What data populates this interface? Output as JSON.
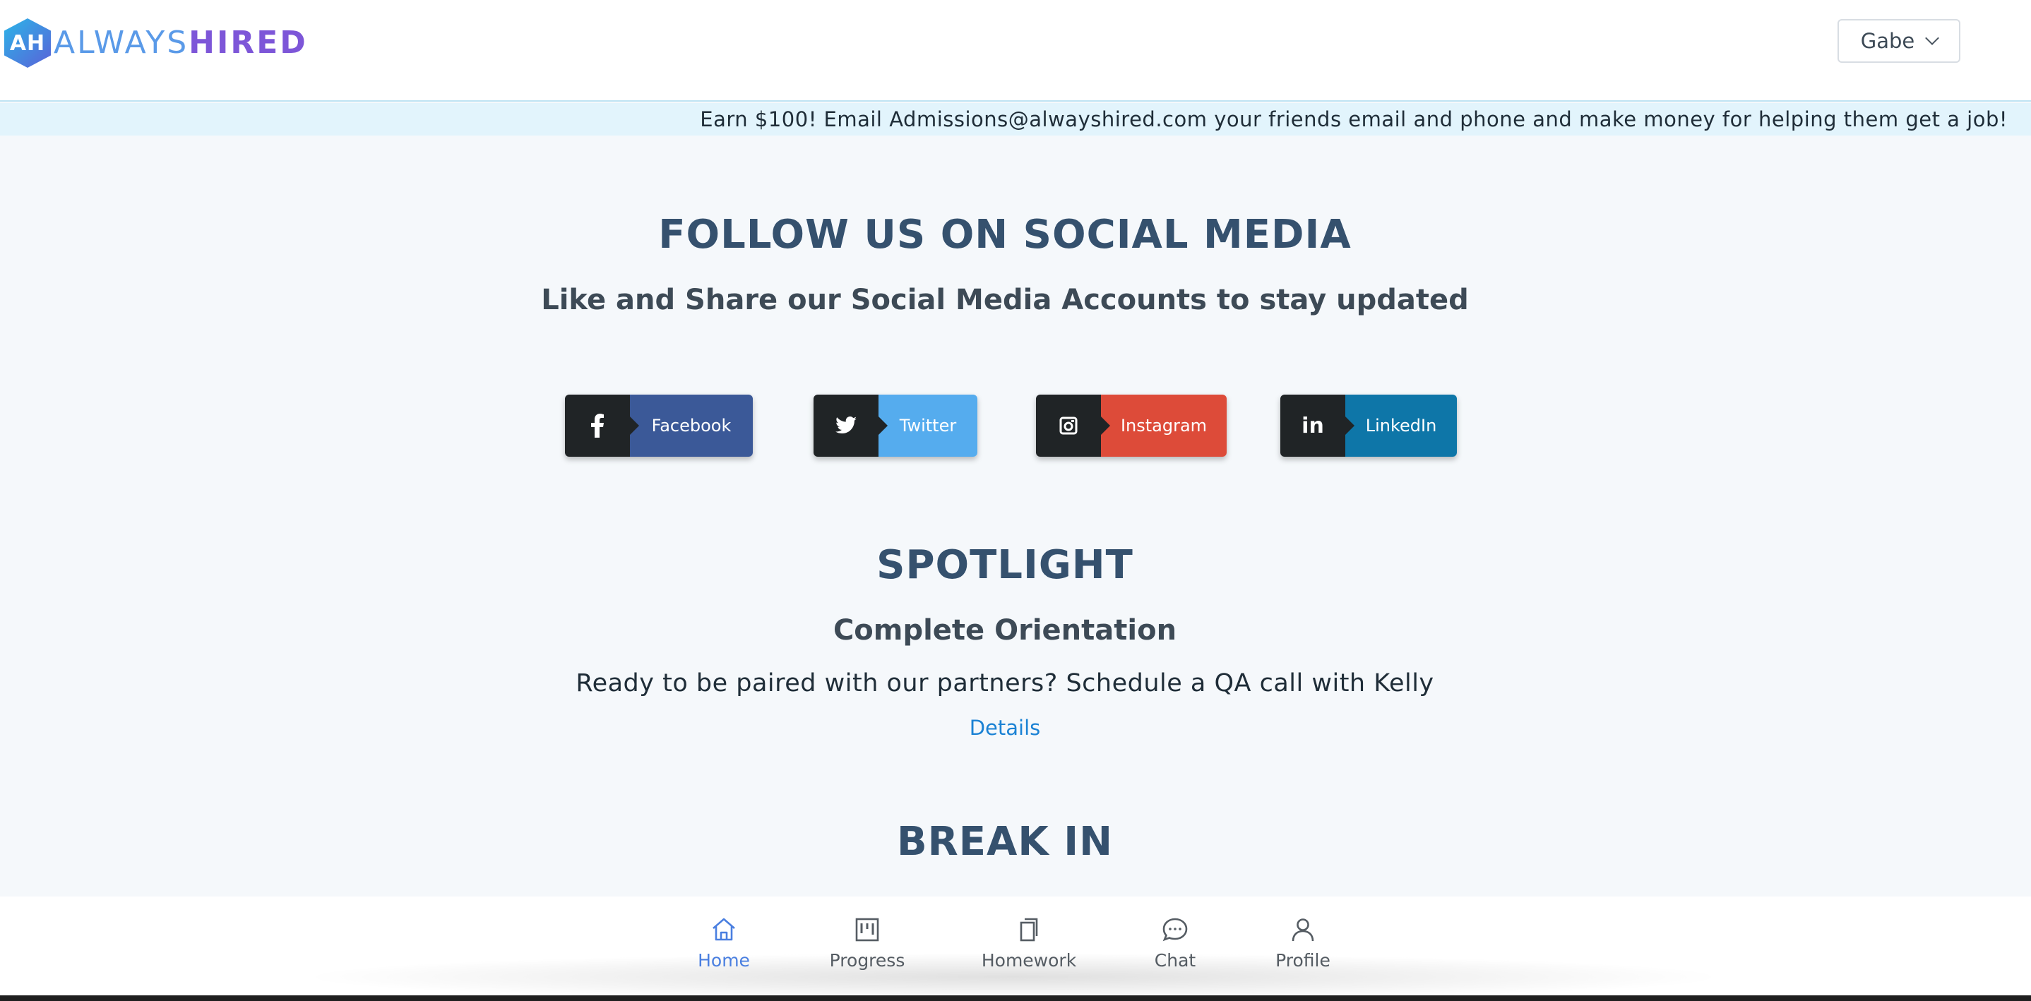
{
  "header": {
    "logo": {
      "mark": "AH",
      "word_a": "ALWAYS",
      "word_b": "HIRED"
    },
    "user_menu": {
      "label": "Gabe"
    }
  },
  "banner": {
    "text": "Earn $100! Email Admissions@alwayshired.com your friends email and phone and make money for helping them get a job!"
  },
  "social": {
    "title": "FOLLOW US ON SOCIAL MEDIA",
    "subtitle": "Like and Share our Social Media Accounts to stay updated",
    "buttons": [
      {
        "icon": "facebook-icon",
        "glyph": "f",
        "label": "Facebook",
        "color": "#3b5998"
      },
      {
        "icon": "twitter-icon",
        "glyph": "🐦",
        "label": "Twitter",
        "color": "#55acee"
      },
      {
        "icon": "instagram-icon",
        "glyph": "◙",
        "label": "Instagram",
        "color": "#dd4b39"
      },
      {
        "icon": "linkedin-icon",
        "glyph": "in",
        "label": "LinkedIn",
        "color": "#0e76a8"
      }
    ]
  },
  "spotlight": {
    "title": "SPOTLIGHT",
    "heading": "Complete Orientation",
    "text": "Ready to be paired with our partners? Schedule a QA call with Kelly",
    "link": "Details"
  },
  "break_in": {
    "title": "BREAK IN"
  },
  "bottom_nav": {
    "items": [
      {
        "label": "Home",
        "icon": "home-icon",
        "active": true
      },
      {
        "label": "Progress",
        "icon": "kanban-icon",
        "active": false
      },
      {
        "label": "Homework",
        "icon": "copy-icon",
        "active": false
      },
      {
        "label": "Chat",
        "icon": "chat-bubble-icon",
        "active": false
      },
      {
        "label": "Profile",
        "icon": "user-icon",
        "active": false
      }
    ]
  },
  "colors": {
    "accent": "#4a7fe0",
    "heading": "#35516e",
    "link": "#1b82d4",
    "banner_bg": "#e2f4fc"
  }
}
